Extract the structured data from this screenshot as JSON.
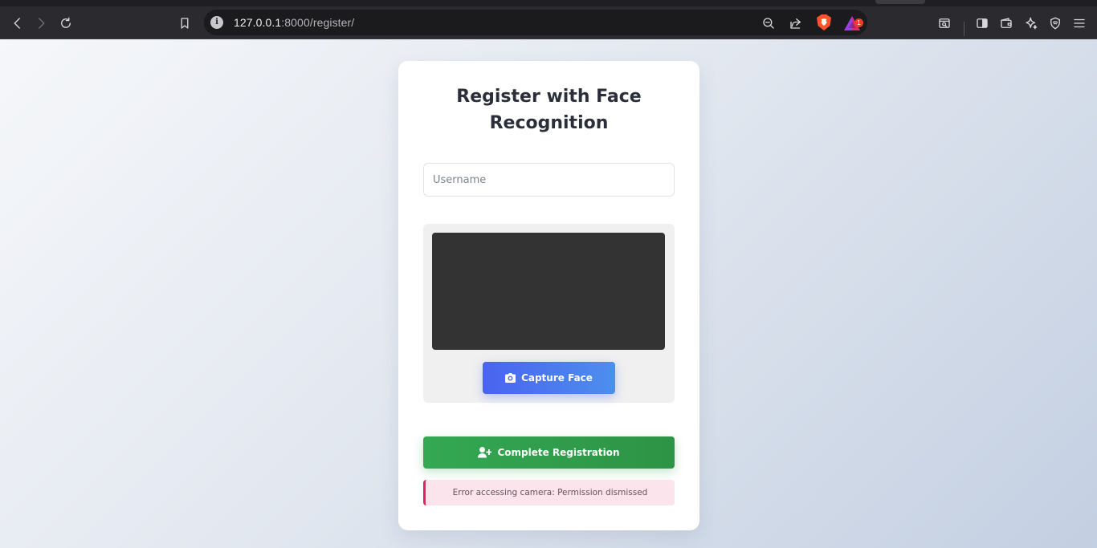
{
  "browser": {
    "url_host": "127.0.0.1",
    "url_path": ":8000/register/",
    "rewards_badge": "1",
    "icons": [
      "back-icon",
      "forward-icon",
      "reload-icon",
      "bookmark-icon",
      "site-info-icon",
      "zoom-out-icon",
      "share-icon",
      "brave-shields-icon",
      "brave-rewards-icon",
      "reader-mode-icon",
      "sidebar-icon",
      "wallet-icon",
      "leo-ai-icon",
      "vpn-icon",
      "menu-icon"
    ]
  },
  "register": {
    "title": "Register with Face Recognition",
    "username_placeholder": "Username",
    "capture_label": "Capture Face",
    "complete_label": "Complete Registration",
    "error_message": "Error accessing camera: Permission dismissed"
  },
  "colors": {
    "accent_blue": "#4a7bef",
    "capture_gradient": [
      "#4a63ef",
      "#4c8fee"
    ],
    "success_green": "#34a853",
    "error_border": "#e91e63",
    "error_bg": "#fce4ec",
    "video_bg": "#333333"
  }
}
